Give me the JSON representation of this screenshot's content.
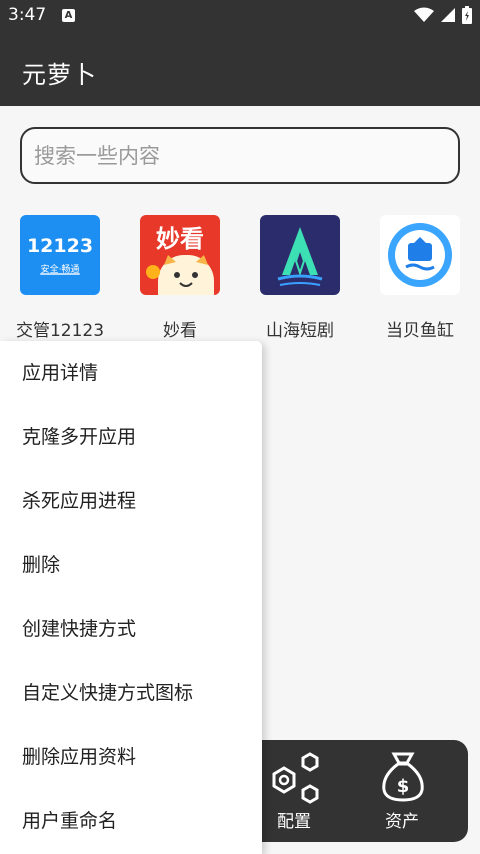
{
  "status_bar": {
    "time": "3:47",
    "notification_icon": "A"
  },
  "app_bar": {
    "title": "元萝卜"
  },
  "search": {
    "placeholder": "搜索一些内容"
  },
  "apps": [
    {
      "label": "交管12123",
      "icon": "app-12123-icon",
      "icon_text": "12123",
      "icon_subtext": "安全·畅通"
    },
    {
      "label": "妙看",
      "icon": "app-miaokan-icon",
      "icon_text": "妙看"
    },
    {
      "label": "山海短剧",
      "icon": "app-shanhai-icon"
    },
    {
      "label": "当贝鱼缸",
      "icon": "app-dangbei-icon"
    }
  ],
  "context_menu": {
    "items": [
      "应用详情",
      "克隆多开应用",
      "杀死应用进程",
      "删除",
      "创建快捷方式",
      "自定义快捷方式图标",
      "删除应用资料",
      "用户重命名"
    ]
  },
  "bottom_nav": {
    "items": [
      {
        "label": "配置",
        "icon": "config-hexagons-icon"
      },
      {
        "label": "资产",
        "icon": "money-bag-icon"
      }
    ]
  },
  "colors": {
    "dark": "#333333",
    "background": "#f6f6f6",
    "accent_blue": "#1d8ef2",
    "accent_red": "#e73829"
  }
}
